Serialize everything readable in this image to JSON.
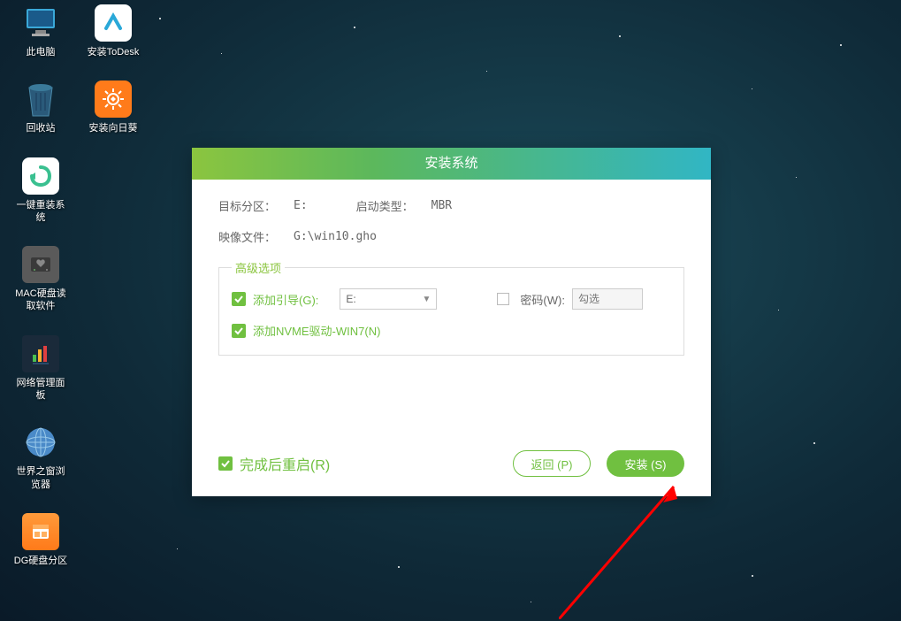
{
  "desktop": {
    "icons": [
      {
        "label": "此电脑"
      },
      {
        "label": "安装ToDesk"
      },
      {
        "label": "回收站"
      },
      {
        "label": "安装向日葵"
      },
      {
        "label": "一键重装系统"
      },
      {
        "label": "MAC硬盘读取软件"
      },
      {
        "label": "网络管理面板"
      },
      {
        "label": "世界之窗浏览器"
      },
      {
        "label": "DG硬盘分区"
      }
    ]
  },
  "dialog": {
    "title": "安装系统",
    "target_label": "目标分区：",
    "target_value": "E:",
    "boot_label": "启动类型：",
    "boot_value": "MBR",
    "image_label": "映像文件：",
    "image_value": "G:\\win10.gho",
    "adv_legend": "高级选项",
    "add_boot_label": "添加引导(G):",
    "add_boot_value": "E:",
    "pwd_label": "密码(W):",
    "pwd_placeholder": "勾选",
    "nvme_label": "添加NVME驱动-WIN7(N)",
    "restart_label": "完成后重启(R)",
    "back_btn": "返回 (P)",
    "install_btn": "安装 (S)"
  }
}
